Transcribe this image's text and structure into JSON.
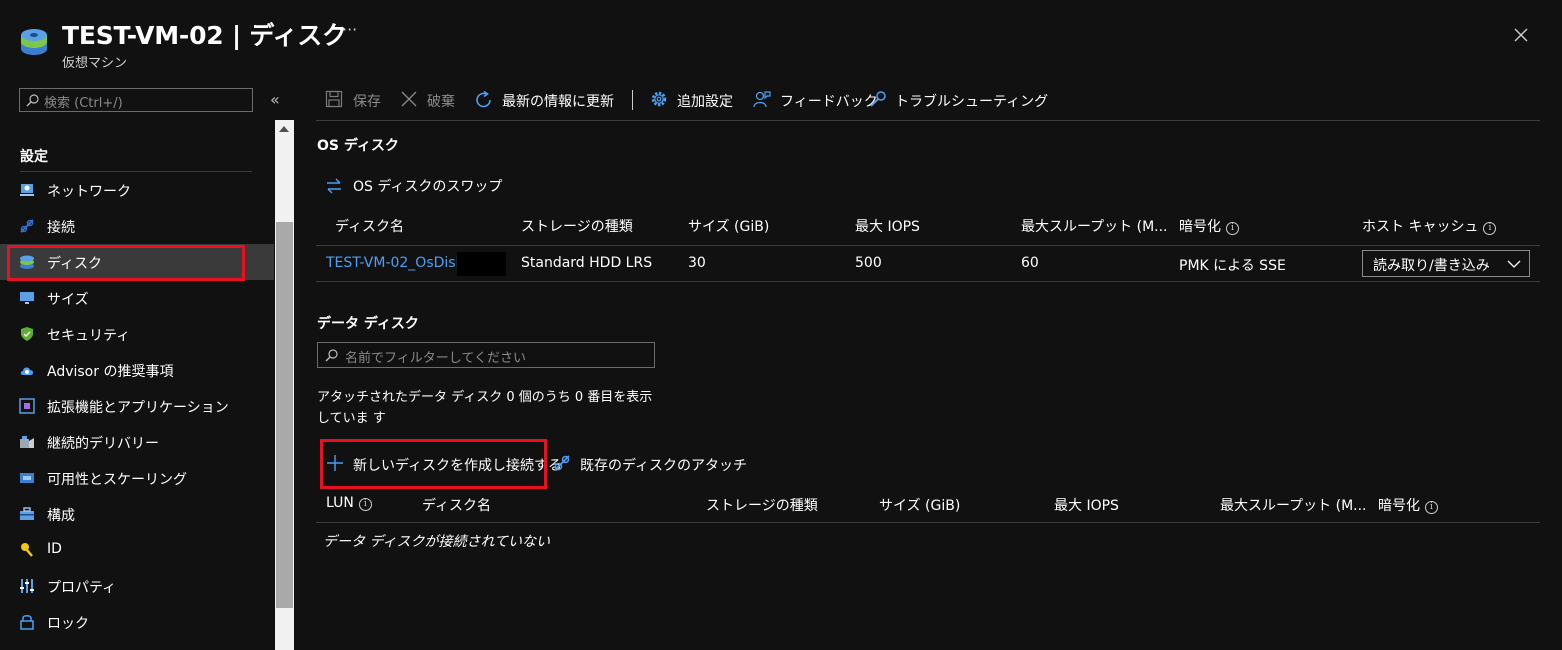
{
  "header": {
    "title": "TEST-VM-02 | ディスク",
    "subtitle": "仮想マシン",
    "more": "···"
  },
  "left_search": {
    "placeholder": "検索 (Ctrl+/)",
    "collapse": "«"
  },
  "sidebar": {
    "section": "設定",
    "items": [
      {
        "label": "ネットワーク",
        "icon": "network-icon"
      },
      {
        "label": "接続",
        "icon": "connect-icon"
      },
      {
        "label": "ディスク",
        "icon": "disk-icon",
        "active": true
      },
      {
        "label": "サイズ",
        "icon": "monitor-icon"
      },
      {
        "label": "セキュリティ",
        "icon": "shield-icon"
      },
      {
        "label": "Advisor の推奨事項",
        "icon": "advisor-cloud-icon"
      },
      {
        "label": "拡張機能とアプリケーション",
        "icon": "extensions-icon"
      },
      {
        "label": "継続的デリバリー",
        "icon": "delivery-icon"
      },
      {
        "label": "可用性とスケーリング",
        "icon": "availability-icon"
      },
      {
        "label": "構成",
        "icon": "toolbox-icon"
      },
      {
        "label": "ID",
        "icon": "key-icon"
      },
      {
        "label": "プロパティ",
        "icon": "properties-icon"
      },
      {
        "label": "ロック",
        "icon": "lock-icon"
      }
    ]
  },
  "toolbar": {
    "save": "保存",
    "discard": "破棄",
    "refresh": "最新の情報に更新",
    "settings": "追加設定",
    "feedback": "フィードバック",
    "troubleshoot": "トラブルシューティング"
  },
  "os_disk": {
    "heading": "OS ディスク",
    "swap": "OS ディスクのスワップ",
    "columns": [
      "ディスク名",
      "ストレージの種類",
      "サイズ (GiB)",
      "最大 IOPS",
      "最大スループット (M...",
      "暗号化",
      "ホスト キャッシュ"
    ],
    "row": {
      "name": "TEST-VM-02_OsDisk_",
      "storage": "Standard HDD LRS",
      "size": "30",
      "iops": "500",
      "throughput": "60",
      "encryption": "PMK による SSE",
      "cache": "読み取り/書き込み"
    }
  },
  "data_disks": {
    "heading": "データ ディスク",
    "filter_placeholder": "名前でフィルターしてください",
    "count_text": "アタッチされたデータ ディスク 0 個のうち 0 番目を表示していま す",
    "create_attach": "新しいディスクを作成し接続する",
    "attach_existing": "既存のディスクのアタッチ",
    "columns": [
      "LUN",
      "ディスク名",
      "ストレージの種類",
      "サイズ (GiB)",
      "最大 IOPS",
      "最大スループット (M...",
      "暗号化"
    ],
    "empty": "データ ディスクが接続されていない"
  },
  "colors": {
    "accent": "#4ba0f5",
    "highlight": "#e81123",
    "background": "#111111"
  }
}
